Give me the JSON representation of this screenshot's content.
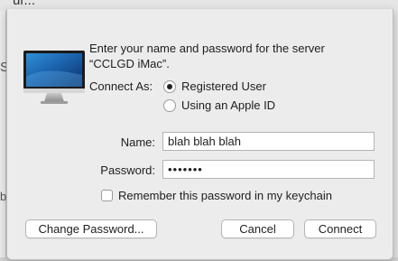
{
  "background": {
    "title_fragment": "ur...",
    "left_fragment_1": "S",
    "left_fragment_2": "b"
  },
  "dialog": {
    "icon": "imac-icon",
    "prompt_line1": "Enter your name and password for the server",
    "prompt_line2": "“CCLGD iMac”.",
    "connect_as_label": "Connect As:",
    "radio_options": [
      {
        "label": "Registered User",
        "selected": true
      },
      {
        "label": "Using an Apple ID",
        "selected": false
      }
    ],
    "name_label": "Name:",
    "name_value": "blah blah blah",
    "password_label": "Password:",
    "password_value": "•••••••",
    "remember_label": "Remember this password in my keychain",
    "remember_checked": false,
    "buttons": {
      "change_password": "Change Password...",
      "cancel": "Cancel",
      "connect": "Connect"
    }
  }
}
